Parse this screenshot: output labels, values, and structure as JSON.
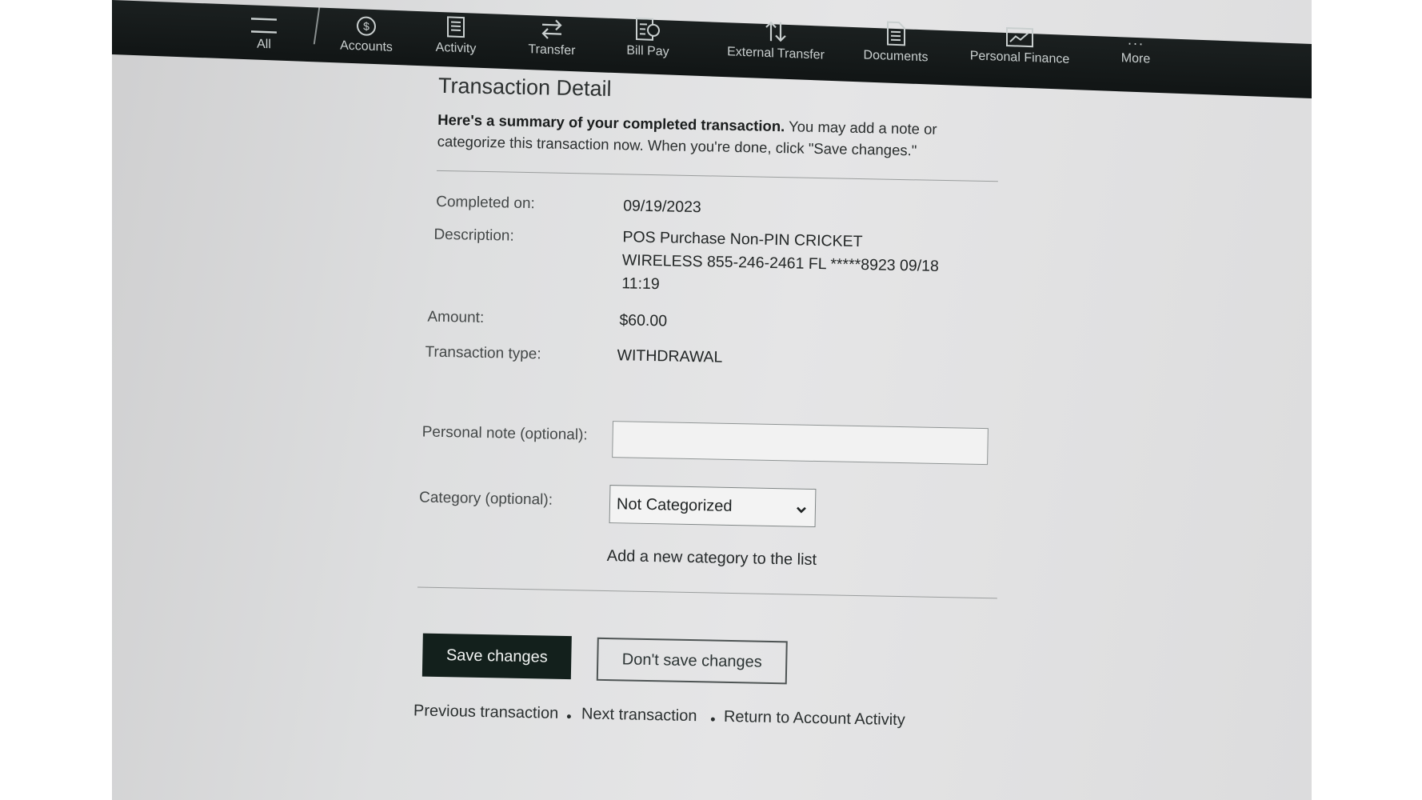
{
  "nav": {
    "items": [
      {
        "label": "All",
        "icon": "hamburger-icon"
      },
      {
        "label": "Accounts",
        "icon": "dollar-coin-icon"
      },
      {
        "label": "Activity",
        "icon": "list-document-icon"
      },
      {
        "label": "Transfer",
        "icon": "transfer-arrows-icon"
      },
      {
        "label": "Bill Pay",
        "icon": "bill-pay-icon"
      },
      {
        "label": "External Transfer",
        "icon": "up-down-arrows-icon"
      },
      {
        "label": "Documents",
        "icon": "document-icon"
      },
      {
        "label": "Personal Finance",
        "icon": "line-chart-icon"
      },
      {
        "label": "More",
        "icon": "ellipsis-icon"
      }
    ]
  },
  "page": {
    "title": "Transaction Detail",
    "intro_bold": "Here's a summary of your completed transaction.",
    "intro_rest": " You may add a note or categorize this transaction now. When you're done, click \"Save changes.\""
  },
  "details": {
    "completed_label": "Completed on:",
    "completed_value": "09/19/2023",
    "description_label": "Description:",
    "description_line1": "POS Purchase Non-PIN CRICKET",
    "description_line2": "WIRELESS 855-246-2461 FL *****8923 09/18",
    "description_line3": "11:19",
    "amount_label": "Amount:",
    "amount_value": "$60.00",
    "type_label": "Transaction type:",
    "type_value": "WITHDRAWAL"
  },
  "form": {
    "note_label": "Personal note (optional):",
    "note_value": "",
    "category_label": "Category (optional):",
    "category_selected": "Not Categorized",
    "add_category_link": "Add a new category to the list"
  },
  "actions": {
    "save_label": "Save changes",
    "dont_save_label": "Don't save changes"
  },
  "footer_links": {
    "previous": "Previous transaction",
    "next": "Next transaction",
    "return": "Return to Account Activity"
  },
  "colors": {
    "nav_bg": "#151a1a",
    "primary_button": "#13201c",
    "screen_bg": "#e0e0e1"
  }
}
